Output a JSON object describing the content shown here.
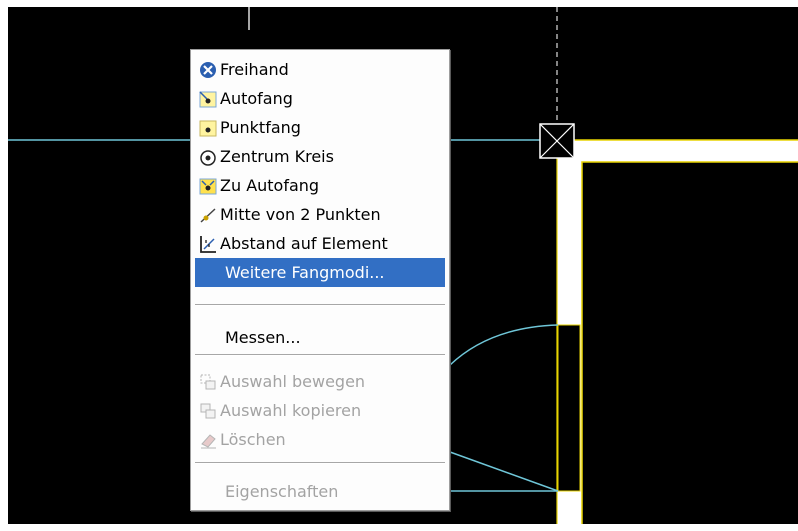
{
  "colors": {
    "canvas_bg": "#000000",
    "page_bg": "#ffffff",
    "cyan_line": "#6fc6d8",
    "wall_yellow": "#e8d400",
    "menu_bg": "#fdfdfd",
    "highlight": "#326fc4"
  },
  "context_menu": {
    "items": [
      {
        "label": "Freihand",
        "icon": "freehand-icon",
        "enabled": true
      },
      {
        "label": "Autofang",
        "icon": "autosnap-icon",
        "enabled": true
      },
      {
        "label": "Punktfang",
        "icon": "pointsnap-icon",
        "enabled": true
      },
      {
        "label": "Zentrum Kreis",
        "icon": "circle-center-icon",
        "enabled": true
      },
      {
        "label": "Zu Autofang",
        "icon": "to-autosnap-icon",
        "enabled": true
      },
      {
        "label": "Mitte von 2 Punkten",
        "icon": "midpoint-icon",
        "enabled": true
      },
      {
        "label": "Abstand auf Element",
        "icon": "distance-on-element-icon",
        "enabled": true
      },
      {
        "label": "Weitere Fangmodi...",
        "icon": "",
        "enabled": true,
        "highlighted": true
      },
      {
        "label": "Messen...",
        "icon": "",
        "enabled": true
      },
      {
        "label": "Auswahl bewegen",
        "icon": "move-selection-icon",
        "enabled": false
      },
      {
        "label": "Auswahl kopieren",
        "icon": "copy-selection-icon",
        "enabled": false
      },
      {
        "label": "Löschen",
        "icon": "eraser-icon",
        "enabled": false
      },
      {
        "label": "Eigenschaften",
        "icon": "",
        "enabled": false
      }
    ]
  }
}
